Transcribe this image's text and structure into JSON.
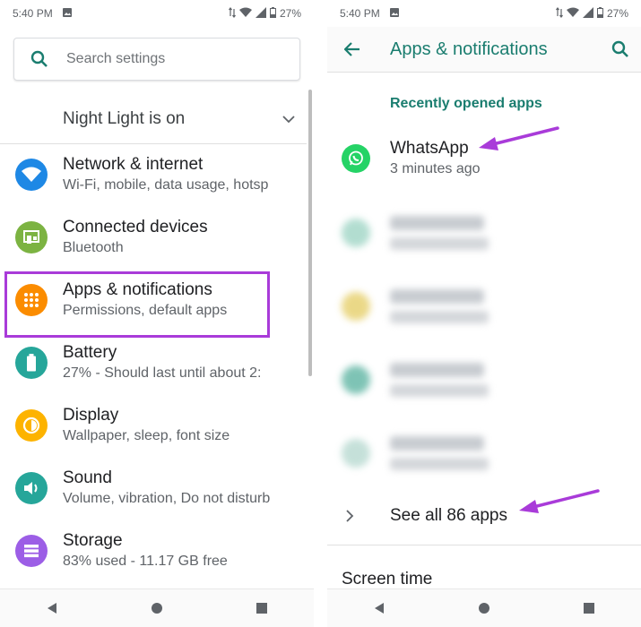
{
  "left": {
    "status": {
      "time": "5:40 PM",
      "battery": "27%"
    },
    "search": {
      "placeholder": "Search settings"
    },
    "night_light": {
      "label": "Night Light is on"
    },
    "items": [
      {
        "title": "Network & internet",
        "subtitle": "Wi-Fi, mobile, data usage, hotsp",
        "icon": "wifi-icon",
        "color": "#1e88e5"
      },
      {
        "title": "Connected devices",
        "subtitle": "Bluetooth",
        "icon": "connected-devices-icon",
        "color": "#7cb342"
      },
      {
        "title": "Apps & notifications",
        "subtitle": "Permissions, default apps",
        "icon": "apps-icon",
        "color": "#fb8c00"
      },
      {
        "title": "Battery",
        "subtitle": "27% - Should last until about 2:",
        "icon": "battery-icon",
        "color": "#26a69a"
      },
      {
        "title": "Display",
        "subtitle": "Wallpaper, sleep, font size",
        "icon": "display-icon",
        "color": "#fdb300"
      },
      {
        "title": "Sound",
        "subtitle": "Volume, vibration, Do not disturb",
        "icon": "sound-icon",
        "color": "#26a69a"
      },
      {
        "title": "Storage",
        "subtitle": "83% used - 11.17 GB free",
        "icon": "storage-icon",
        "color": "#9c5ee6"
      }
    ]
  },
  "right": {
    "status": {
      "time": "5:40 PM",
      "battery": "27%"
    },
    "appbar": {
      "title": "Apps & notifications"
    },
    "recent": {
      "header": "Recently opened apps",
      "whatsapp": {
        "name": "WhatsApp",
        "time": "3 minutes ago"
      }
    },
    "see_all": "See all 86 apps",
    "screen_time": "Screen time"
  },
  "colors": {
    "accent": "#1a7d6f",
    "highlight": "#a93bd9",
    "whatsapp": "#25d366"
  }
}
